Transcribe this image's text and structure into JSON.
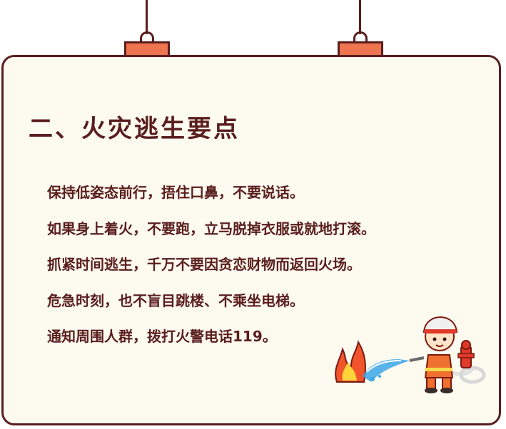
{
  "section": {
    "title": "二、火灾逃生要点",
    "tips": [
      "保持低姿态前行，捂住口鼻，不要说话。",
      "如果身上着火，不要跑，立马脱掉衣服或就地打滚。",
      "抓紧时间逃生，千万不要因贪恋财物而返回火场。",
      "危急时刻，也不盲目跳楼、不乘坐电梯。",
      "通知周围人群，拨打火警电话119。"
    ]
  },
  "colors": {
    "text": "#5a1e1e",
    "card_background": "#fdfaf0",
    "hanger_tab": "#ef7450",
    "fire": "#f2552b",
    "water": "#3aa6e8"
  },
  "illustration": {
    "icons": [
      "fire-icon",
      "water-spray-icon",
      "firefighter-icon",
      "fire-hydrant-icon"
    ]
  }
}
